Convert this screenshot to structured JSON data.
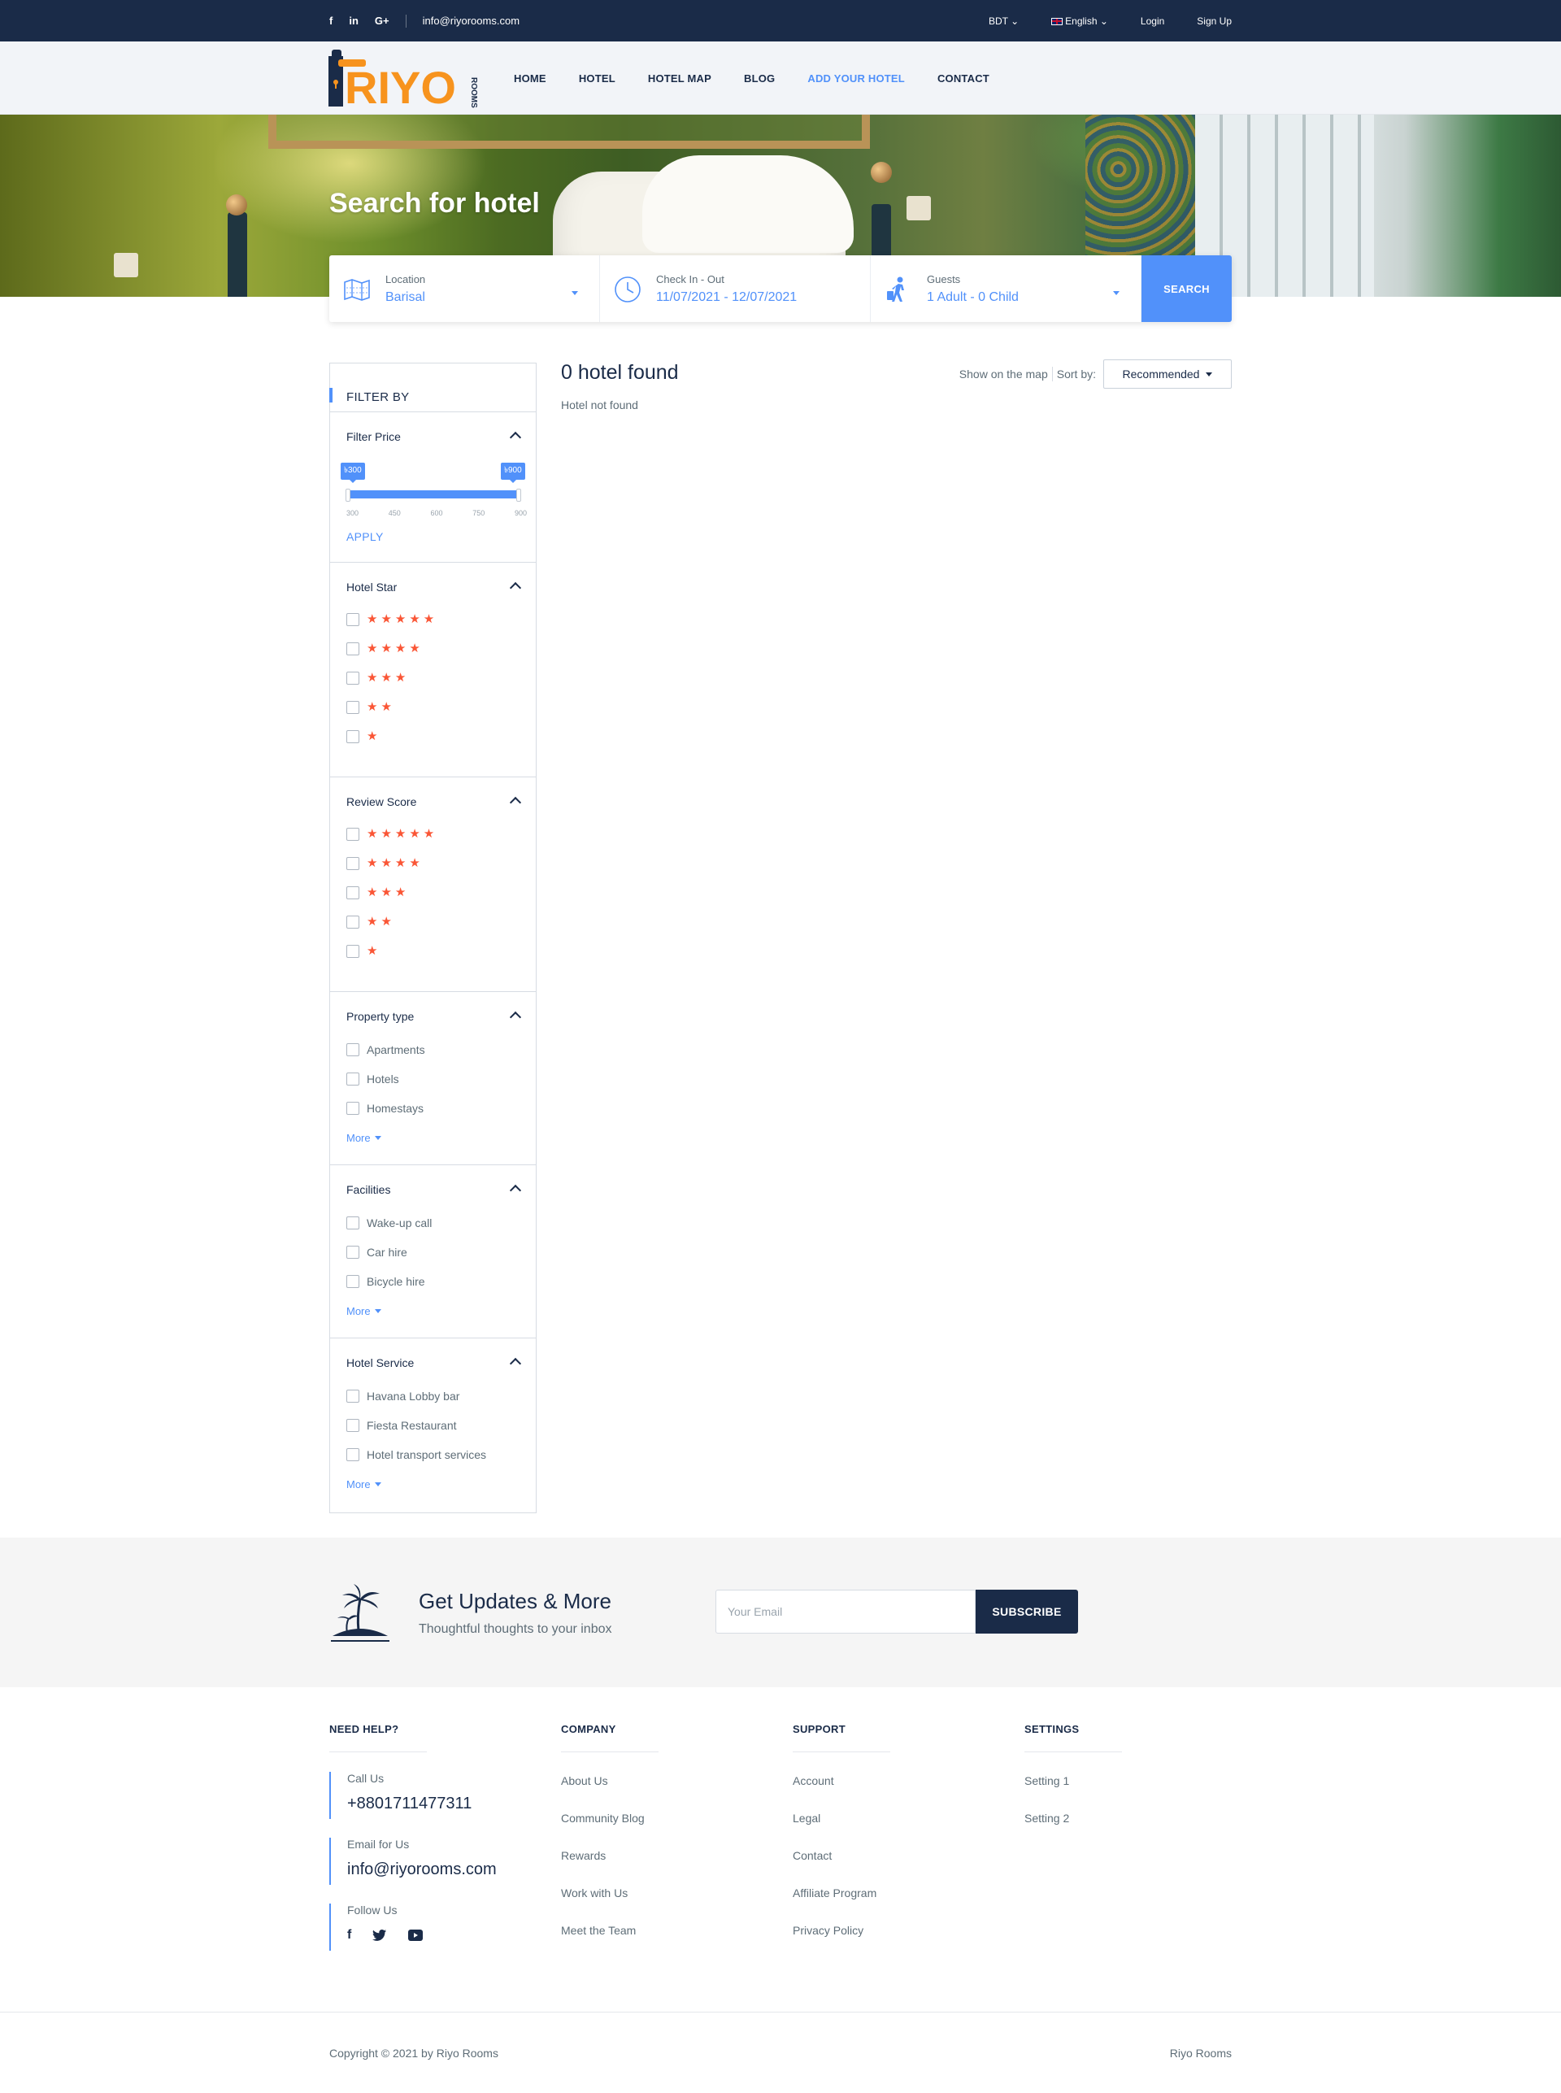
{
  "topbar": {
    "social": [
      "f",
      "in",
      "G+"
    ],
    "email": "info@riyorooms.com",
    "currency": "BDT",
    "language": "English",
    "login": "Login",
    "signup": "Sign Up"
  },
  "logo": {
    "text": "RIYO",
    "sub": "ROOMS"
  },
  "nav": [
    "HOME",
    "HOTEL",
    "HOTEL MAP",
    "BLOG",
    "ADD YOUR HOTEL",
    "CONTACT"
  ],
  "hero": {
    "title": "Search for hotel"
  },
  "search": {
    "location_label": "Location",
    "location_value": "Barisal",
    "dates_label": "Check In - Out",
    "dates_value": "11/07/2021 - 12/07/2021",
    "guests_label": "Guests",
    "guests_value": "1 Adult - 0 Child",
    "button": "SEARCH"
  },
  "filters": {
    "heading": "FILTER BY",
    "price": {
      "title": "Filter Price",
      "min_tag": "৳300",
      "max_tag": "৳900",
      "ticks": [
        "300",
        "450",
        "600",
        "750",
        "900"
      ],
      "range": [
        300,
        900
      ],
      "selected": [
        300,
        900
      ],
      "apply": "APPLY"
    },
    "hotel_star": {
      "title": "Hotel Star",
      "options": [
        "★★★★★",
        "★★★★",
        "★★★",
        "★★",
        "★"
      ]
    },
    "review_score": {
      "title": "Review Score",
      "options": [
        "★★★★★",
        "★★★★",
        "★★★",
        "★★",
        "★"
      ]
    },
    "property_type": {
      "title": "Property type",
      "options": [
        "Apartments",
        "Hotels",
        "Homestays"
      ],
      "more": "More"
    },
    "facilities": {
      "title": "Facilities",
      "options": [
        "Wake-up call",
        "Car hire",
        "Bicycle hire"
      ],
      "more": "More"
    },
    "hotel_service": {
      "title": "Hotel Service",
      "options": [
        "Havana Lobby bar",
        "Fiesta Restaurant",
        "Hotel transport services"
      ],
      "more": "More"
    }
  },
  "results": {
    "count": "0 hotel found",
    "empty": "Hotel not found",
    "show_map": "Show on the map",
    "sort_label": "Sort by:",
    "sort_value": "Recommended"
  },
  "newsletter": {
    "title": "Get Updates & More",
    "subtitle": "Thoughtful thoughts to your inbox",
    "placeholder": "Your Email",
    "button": "SUBSCRIBE"
  },
  "footer": {
    "help": {
      "heading": "NEED HELP?",
      "call_label": "Call Us",
      "call_value": "+8801711477311",
      "email_label": "Email for Us",
      "email_value": "info@riyorooms.com",
      "follow_label": "Follow Us"
    },
    "company": {
      "heading": "COMPANY",
      "links": [
        "About Us",
        "Community Blog",
        "Rewards",
        "Work with Us",
        "Meet the Team"
      ]
    },
    "support": {
      "heading": "SUPPORT",
      "links": [
        "Account",
        "Legal",
        "Contact",
        "Affiliate Program",
        "Privacy Policy"
      ]
    },
    "settings": {
      "heading": "SETTINGS",
      "links": [
        "Setting 1",
        "Setting 2"
      ]
    },
    "copyright": "Copyright © 2021 by Riyo Rooms",
    "brand": "Riyo Rooms"
  },
  "colors": {
    "navy": "#1a2b48",
    "accent": "#5191fa",
    "star": "#fa5636",
    "logo_orange": "#f7931e"
  }
}
